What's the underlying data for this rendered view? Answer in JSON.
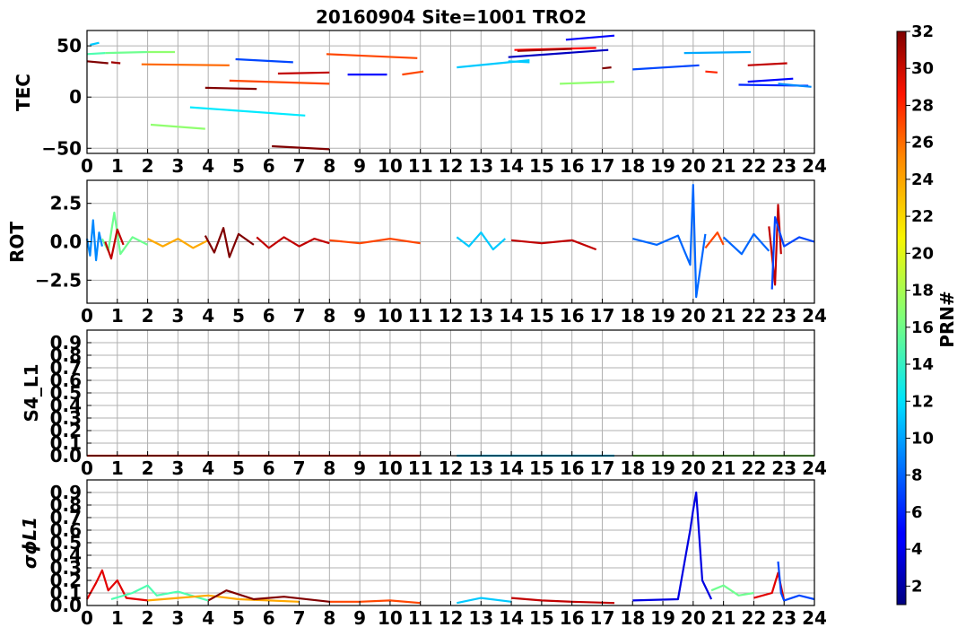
{
  "title": "20160904 Site=1001 TRO2",
  "colorbar": {
    "label": "PRN#",
    "range": [
      1,
      32
    ],
    "ticks": [
      "2",
      "4",
      "6",
      "8",
      "10",
      "12",
      "14",
      "16",
      "18",
      "20",
      "22",
      "24",
      "26",
      "28",
      "30",
      "32"
    ]
  },
  "panels": [
    {
      "ylabel": "TEC",
      "xticks": [
        "0",
        "1",
        "2",
        "3",
        "4",
        "5",
        "6",
        "7",
        "8",
        "9",
        "10",
        "11",
        "12",
        "13",
        "14",
        "15",
        "16",
        "17",
        "18",
        "19",
        "20",
        "21",
        "22",
        "23",
        "24"
      ],
      "yticks": [
        "−50",
        "0",
        "50"
      ]
    },
    {
      "ylabel": "ROT",
      "xticks": [
        "0",
        "1",
        "2",
        "3",
        "4",
        "5",
        "6",
        "7",
        "8",
        "9",
        "10",
        "11",
        "12",
        "13",
        "14",
        "15",
        "16",
        "17",
        "18",
        "19",
        "20",
        "21",
        "22",
        "23",
        "24"
      ],
      "yticks": [
        "−2.5",
        "0.0",
        "2.5"
      ]
    },
    {
      "ylabel": "S4_L1",
      "xticks": [
        "0",
        "1",
        "2",
        "3",
        "4",
        "5",
        "6",
        "7",
        "8",
        "9",
        "10",
        "11",
        "12",
        "13",
        "14",
        "15",
        "16",
        "17",
        "18",
        "19",
        "20",
        "21",
        "22",
        "23",
        "24"
      ],
      "yticks": [
        "0.0",
        "0.1",
        "0.2",
        "0.3",
        "0.4",
        "0.5",
        "0.6",
        "0.7",
        "0.8",
        "0.9"
      ]
    },
    {
      "ylabel": "σϕL1",
      "xticks": [
        "0",
        "1",
        "2",
        "3",
        "4",
        "5",
        "6",
        "7",
        "8",
        "9",
        "10",
        "11",
        "12",
        "13",
        "14",
        "15",
        "16",
        "17",
        "18",
        "19",
        "20",
        "21",
        "22",
        "23",
        "24"
      ],
      "yticks": [
        "0.0",
        "0.1",
        "0.2",
        "0.3",
        "0.4",
        "0.5",
        "0.6",
        "0.7",
        "0.8",
        "0.9"
      ]
    }
  ],
  "chart_data": [
    {
      "type": "line",
      "ylabel": "TEC",
      "xlim": [
        0,
        24
      ],
      "ylim": [
        -55,
        65
      ],
      "grid": true,
      "series": [
        {
          "prn": 11,
          "x": [
            0.1,
            0.4
          ],
          "y": [
            51,
            53
          ]
        },
        {
          "prn": 15,
          "x": [
            0.0,
            0.6
          ],
          "y": [
            42,
            43
          ]
        },
        {
          "prn": 32,
          "x": [
            0.0,
            0.7
          ],
          "y": [
            35,
            33
          ]
        },
        {
          "prn": 16,
          "x": [
            0.6,
            2.0
          ],
          "y": [
            43,
            44
          ]
        },
        {
          "prn": 31,
          "x": [
            0.8,
            1.1
          ],
          "y": [
            34,
            33
          ]
        },
        {
          "prn": 17,
          "x": [
            2.0,
            2.9
          ],
          "y": [
            44,
            44
          ]
        },
        {
          "prn": 25,
          "x": [
            1.8,
            4.7
          ],
          "y": [
            32,
            31
          ]
        },
        {
          "prn": 17,
          "x": [
            2.1,
            3.9
          ],
          "y": [
            -27,
            -31
          ]
        },
        {
          "prn": 12,
          "x": [
            3.4,
            7.2
          ],
          "y": [
            -10,
            -18
          ]
        },
        {
          "prn": 32,
          "x": [
            3.9,
            5.6
          ],
          "y": [
            9,
            8
          ]
        },
        {
          "prn": 26,
          "x": [
            4.7,
            8.0
          ],
          "y": [
            16,
            13
          ]
        },
        {
          "prn": 7,
          "x": [
            4.9,
            6.8
          ],
          "y": [
            37,
            34
          ]
        },
        {
          "prn": 32,
          "x": [
            6.1,
            8.0
          ],
          "y": [
            -48,
            -51
          ]
        },
        {
          "prn": 30,
          "x": [
            6.3,
            8.0
          ],
          "y": [
            23,
            24
          ]
        },
        {
          "prn": 26,
          "x": [
            7.9,
            10.9
          ],
          "y": [
            42,
            38
          ]
        },
        {
          "prn": 5,
          "x": [
            8.6,
            9.9
          ],
          "y": [
            22,
            22
          ]
        },
        {
          "prn": 26,
          "x": [
            10.4,
            11.1
          ],
          "y": [
            22,
            25
          ]
        },
        {
          "prn": 11,
          "x": [
            12.2,
            14.6
          ],
          "y": [
            29,
            36
          ]
        },
        {
          "prn": 11,
          "x": [
            13.9,
            14.6
          ],
          "y": [
            35,
            34
          ]
        },
        {
          "prn": 28,
          "x": [
            14.1,
            16.8
          ],
          "y": [
            46,
            48
          ]
        },
        {
          "prn": 3,
          "x": [
            13.9,
            17.2
          ],
          "y": [
            39,
            46
          ]
        },
        {
          "prn": 31,
          "x": [
            14.2,
            16.0
          ],
          "y": [
            45,
            47
          ]
        },
        {
          "prn": 5,
          "x": [
            15.8,
            17.4
          ],
          "y": [
            56,
            60
          ]
        },
        {
          "prn": 17,
          "x": [
            15.6,
            17.4
          ],
          "y": [
            13,
            15
          ]
        },
        {
          "prn": 32,
          "x": [
            17.0,
            17.3
          ],
          "y": [
            28,
            29
          ]
        },
        {
          "prn": 10,
          "x": [
            19.7,
            21.9
          ],
          "y": [
            43,
            44
          ]
        },
        {
          "prn": 7,
          "x": [
            18.0,
            20.2
          ],
          "y": [
            27,
            31
          ]
        },
        {
          "prn": 27,
          "x": [
            20.4,
            20.8
          ],
          "y": [
            25,
            24
          ]
        },
        {
          "prn": 30,
          "x": [
            21.8,
            23.1
          ],
          "y": [
            31,
            33
          ]
        },
        {
          "prn": 5,
          "x": [
            21.8,
            23.3
          ],
          "y": [
            15,
            18
          ]
        },
        {
          "prn": 6,
          "x": [
            21.5,
            23.8
          ],
          "y": [
            12,
            11
          ]
        },
        {
          "prn": 9,
          "x": [
            22.8,
            23.9
          ],
          "y": [
            13,
            10
          ]
        }
      ]
    },
    {
      "type": "line",
      "ylabel": "ROT",
      "xlim": [
        0,
        24
      ],
      "ylim": [
        -4,
        4
      ],
      "grid": true,
      "series": [
        {
          "prn": 9,
          "x": [
            0.0,
            0.1,
            0.2,
            0.3,
            0.4,
            0.5
          ],
          "y": [
            0.2,
            -0.9,
            1.4,
            -1.2,
            0.6,
            -0.3
          ]
        },
        {
          "prn": 16,
          "x": [
            0.5,
            0.7,
            0.9,
            1.1,
            1.5,
            2.0
          ],
          "y": [
            0.2,
            -0.6,
            1.9,
            -0.8,
            0.3,
            -0.2
          ]
        },
        {
          "prn": 30,
          "x": [
            0.6,
            0.8,
            1.0,
            1.2
          ],
          "y": [
            0.0,
            -1.1,
            0.8,
            -0.2
          ]
        },
        {
          "prn": 23,
          "x": [
            2.0,
            2.5,
            3.0,
            3.5,
            4.0
          ],
          "y": [
            0.2,
            -0.3,
            0.2,
            -0.4,
            0.1
          ]
        },
        {
          "prn": 32,
          "x": [
            3.9,
            4.2,
            4.5,
            4.7,
            5.0,
            5.5
          ],
          "y": [
            0.4,
            -0.7,
            0.9,
            -1.0,
            0.5,
            -0.2
          ]
        },
        {
          "prn": 30,
          "x": [
            5.6,
            6.0,
            6.5,
            7.0,
            7.5,
            8.0
          ],
          "y": [
            0.3,
            -0.4,
            0.3,
            -0.3,
            0.2,
            -0.1
          ]
        },
        {
          "prn": 26,
          "x": [
            8.0,
            9.0,
            10.0,
            11.0
          ],
          "y": [
            0.1,
            -0.1,
            0.2,
            -0.1
          ]
        },
        {
          "prn": 11,
          "x": [
            12.2,
            12.6,
            13.0,
            13.4,
            13.8
          ],
          "y": [
            0.3,
            -0.3,
            0.6,
            -0.5,
            0.2
          ]
        },
        {
          "prn": 30,
          "x": [
            14.0,
            15.0,
            16.0,
            16.8
          ],
          "y": [
            0.1,
            -0.1,
            0.1,
            -0.5
          ]
        },
        {
          "prn": 8,
          "x": [
            18.0,
            18.8,
            19.5,
            19.9,
            20.0,
            20.1,
            20.4
          ],
          "y": [
            0.2,
            -0.2,
            0.4,
            -1.5,
            3.7,
            -3.6,
            0.5
          ]
        },
        {
          "prn": 26,
          "x": [
            20.4,
            20.8,
            21.0
          ],
          "y": [
            -0.4,
            0.6,
            -0.2
          ]
        },
        {
          "prn": 8,
          "x": [
            21.0,
            21.6,
            22.0,
            22.5
          ],
          "y": [
            0.3,
            -0.8,
            0.5,
            -0.6
          ]
        },
        {
          "prn": 30,
          "x": [
            22.5,
            22.7,
            22.8,
            22.9
          ],
          "y": [
            1.0,
            -2.8,
            2.4,
            -0.8
          ]
        },
        {
          "prn": 7,
          "x": [
            22.6,
            22.7,
            23.0,
            23.5,
            24.0
          ],
          "y": [
            -3.1,
            1.6,
            -0.3,
            0.3,
            0.0
          ]
        }
      ]
    },
    {
      "type": "line",
      "ylabel": "S4_L1",
      "xlim": [
        0,
        24
      ],
      "ylim": [
        0.0,
        1.0
      ],
      "grid": true,
      "series": [
        {
          "prn": 27,
          "x": [
            0.0,
            11.0
          ],
          "y": [
            0.0,
            0.0
          ]
        },
        {
          "prn": 11,
          "x": [
            12.2,
            17.4
          ],
          "y": [
            0.0,
            0.0
          ]
        },
        {
          "prn": 17,
          "x": [
            18.0,
            24.0
          ],
          "y": [
            0.0,
            0.0
          ]
        }
      ]
    },
    {
      "type": "line",
      "ylabel": "σϕL1",
      "xlim": [
        0,
        24
      ],
      "ylim": [
        0.0,
        1.0
      ],
      "grid": true,
      "series": [
        {
          "prn": 29,
          "x": [
            0.0,
            0.3,
            0.5,
            0.7,
            1.0,
            1.3,
            2.0
          ],
          "y": [
            0.05,
            0.18,
            0.28,
            0.12,
            0.2,
            0.06,
            0.04
          ]
        },
        {
          "prn": 15,
          "x": [
            0.8,
            1.5,
            2.0,
            2.3,
            3.0,
            4.0
          ],
          "y": [
            0.05,
            0.1,
            0.16,
            0.08,
            0.11,
            0.04
          ]
        },
        {
          "prn": 23,
          "x": [
            2.0,
            3.0,
            4.0,
            5.0,
            6.0,
            7.0
          ],
          "y": [
            0.04,
            0.06,
            0.08,
            0.05,
            0.04,
            0.03
          ]
        },
        {
          "prn": 32,
          "x": [
            4.0,
            4.6,
            5.5,
            6.5,
            8.0
          ],
          "y": [
            0.04,
            0.12,
            0.05,
            0.07,
            0.03
          ]
        },
        {
          "prn": 26,
          "x": [
            8.0,
            9.0,
            10.0,
            11.0
          ],
          "y": [
            0.03,
            0.03,
            0.04,
            0.02
          ]
        },
        {
          "prn": 11,
          "x": [
            12.2,
            13.0,
            14.0
          ],
          "y": [
            0.02,
            0.06,
            0.03
          ]
        },
        {
          "prn": 30,
          "x": [
            14.0,
            15.0,
            16.0,
            17.4
          ],
          "y": [
            0.06,
            0.04,
            0.03,
            0.02
          ]
        },
        {
          "prn": 4,
          "x": [
            18.0,
            19.5,
            19.9,
            20.0,
            20.1,
            20.3,
            20.6
          ],
          "y": [
            0.04,
            0.05,
            0.6,
            0.76,
            0.9,
            0.2,
            0.05
          ]
        },
        {
          "prn": 16,
          "x": [
            20.6,
            21.0,
            21.5,
            22.0
          ],
          "y": [
            0.12,
            0.16,
            0.08,
            0.1
          ]
        },
        {
          "prn": 29,
          "x": [
            22.0,
            22.6,
            22.8,
            23.0
          ],
          "y": [
            0.06,
            0.1,
            0.26,
            0.04
          ]
        },
        {
          "prn": 7,
          "x": [
            22.8,
            22.9,
            23.0,
            23.5,
            24.0
          ],
          "y": [
            0.35,
            0.1,
            0.04,
            0.08,
            0.05
          ]
        }
      ]
    }
  ]
}
